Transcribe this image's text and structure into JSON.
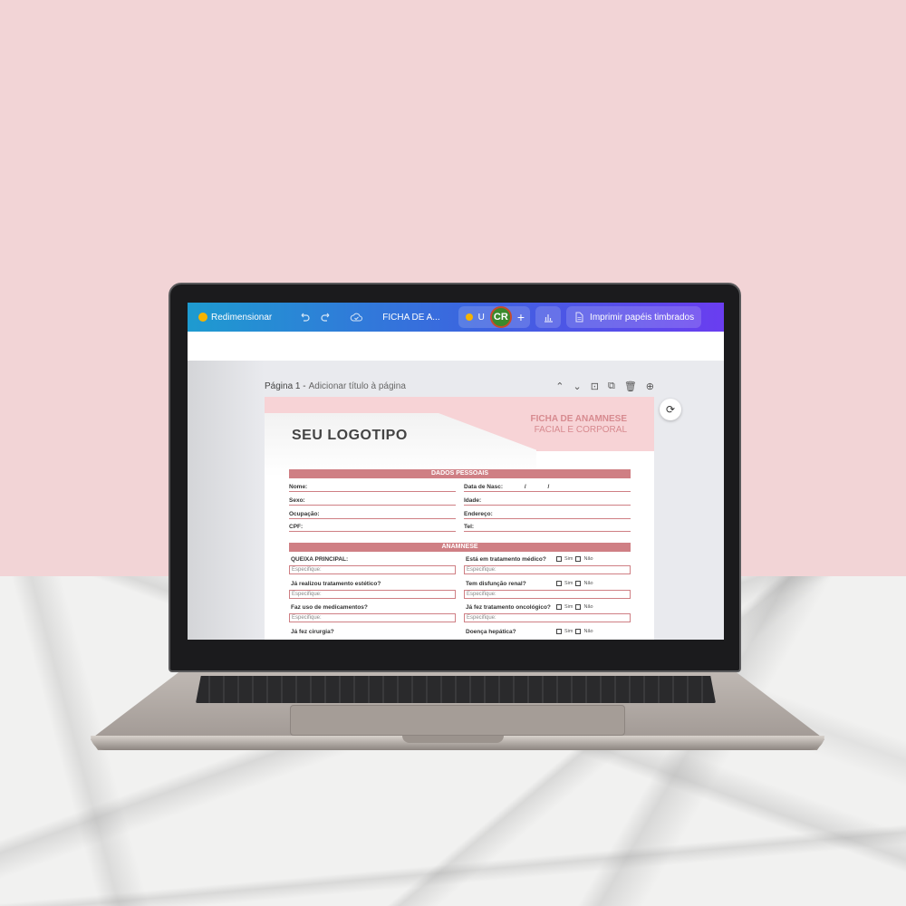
{
  "toolbar": {
    "resize_label": "Redimensionar",
    "doc_name": "FICHA DE A...",
    "upgrade_label": "U",
    "avatar_initials": "CR",
    "add_label": "+",
    "print_label": "Imprimir papéis timbrados"
  },
  "pagebar": {
    "page_label": "Página 1 -",
    "add_title": "Adicionar título à página"
  },
  "document": {
    "logo": "SEU LOGOTIPO",
    "title_line1": "FICHA DE ANAMNESE",
    "title_line2": "FACIAL E CORPORAL",
    "section_personal": "DADOS PESSOAIS",
    "section_anamnese": "ANAMNESE",
    "fields": {
      "nome": "Nome:",
      "data_nasc": "Data de Nasc:",
      "date_slash_1": "/",
      "date_slash_2": "/",
      "sexo": "Sexo:",
      "idade": "Idade:",
      "ocupacao": "Ocupação:",
      "endereco": "Endereço:",
      "cpf": "CPF:",
      "tel": "Tel:"
    },
    "questions": {
      "q1": "QUEIXA PRINCIPAL:",
      "q2": "Está em tratamento médico?",
      "q3": "Já realizou tratamento estético?",
      "q4": "Tem disfunção renal?",
      "q5": "Faz uso de medicamentos?",
      "q6": "Já fez tratamento oncológico?",
      "q7": "Já fez cirurgia?",
      "q8": "Doença hepática?"
    },
    "specify": "Especifique:",
    "sim": "Sim",
    "nao": "Não"
  },
  "colors": {
    "accent": "#cf7f84",
    "header_pink": "#f7d3d6",
    "wall": "#f2d4d6"
  }
}
